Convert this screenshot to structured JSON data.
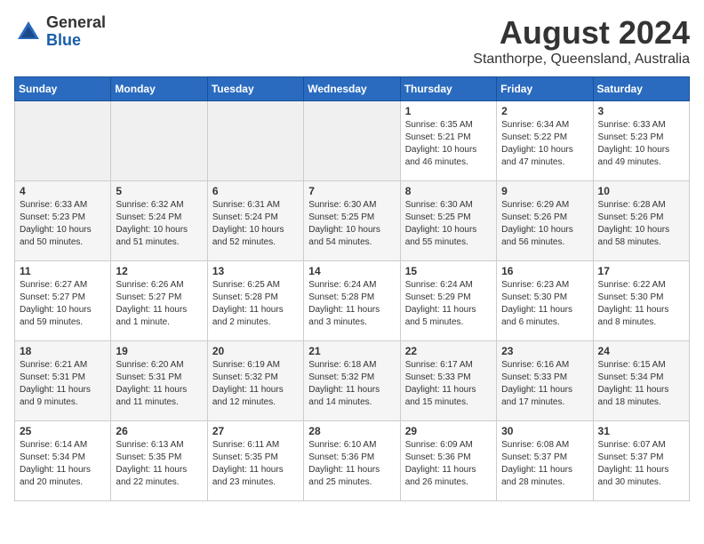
{
  "header": {
    "logo_general": "General",
    "logo_blue": "Blue",
    "month_year": "August 2024",
    "location": "Stanthorpe, Queensland, Australia"
  },
  "weekdays": [
    "Sunday",
    "Monday",
    "Tuesday",
    "Wednesday",
    "Thursday",
    "Friday",
    "Saturday"
  ],
  "weeks": [
    [
      {
        "day": "",
        "sunrise": "",
        "sunset": "",
        "daylight": ""
      },
      {
        "day": "",
        "sunrise": "",
        "sunset": "",
        "daylight": ""
      },
      {
        "day": "",
        "sunrise": "",
        "sunset": "",
        "daylight": ""
      },
      {
        "day": "",
        "sunrise": "",
        "sunset": "",
        "daylight": ""
      },
      {
        "day": "1",
        "sunrise": "Sunrise: 6:35 AM",
        "sunset": "Sunset: 5:21 PM",
        "daylight": "Daylight: 10 hours and 46 minutes."
      },
      {
        "day": "2",
        "sunrise": "Sunrise: 6:34 AM",
        "sunset": "Sunset: 5:22 PM",
        "daylight": "Daylight: 10 hours and 47 minutes."
      },
      {
        "day": "3",
        "sunrise": "Sunrise: 6:33 AM",
        "sunset": "Sunset: 5:23 PM",
        "daylight": "Daylight: 10 hours and 49 minutes."
      }
    ],
    [
      {
        "day": "4",
        "sunrise": "Sunrise: 6:33 AM",
        "sunset": "Sunset: 5:23 PM",
        "daylight": "Daylight: 10 hours and 50 minutes."
      },
      {
        "day": "5",
        "sunrise": "Sunrise: 6:32 AM",
        "sunset": "Sunset: 5:24 PM",
        "daylight": "Daylight: 10 hours and 51 minutes."
      },
      {
        "day": "6",
        "sunrise": "Sunrise: 6:31 AM",
        "sunset": "Sunset: 5:24 PM",
        "daylight": "Daylight: 10 hours and 52 minutes."
      },
      {
        "day": "7",
        "sunrise": "Sunrise: 6:30 AM",
        "sunset": "Sunset: 5:25 PM",
        "daylight": "Daylight: 10 hours and 54 minutes."
      },
      {
        "day": "8",
        "sunrise": "Sunrise: 6:30 AM",
        "sunset": "Sunset: 5:25 PM",
        "daylight": "Daylight: 10 hours and 55 minutes."
      },
      {
        "day": "9",
        "sunrise": "Sunrise: 6:29 AM",
        "sunset": "Sunset: 5:26 PM",
        "daylight": "Daylight: 10 hours and 56 minutes."
      },
      {
        "day": "10",
        "sunrise": "Sunrise: 6:28 AM",
        "sunset": "Sunset: 5:26 PM",
        "daylight": "Daylight: 10 hours and 58 minutes."
      }
    ],
    [
      {
        "day": "11",
        "sunrise": "Sunrise: 6:27 AM",
        "sunset": "Sunset: 5:27 PM",
        "daylight": "Daylight: 10 hours and 59 minutes."
      },
      {
        "day": "12",
        "sunrise": "Sunrise: 6:26 AM",
        "sunset": "Sunset: 5:27 PM",
        "daylight": "Daylight: 11 hours and 1 minute."
      },
      {
        "day": "13",
        "sunrise": "Sunrise: 6:25 AM",
        "sunset": "Sunset: 5:28 PM",
        "daylight": "Daylight: 11 hours and 2 minutes."
      },
      {
        "day": "14",
        "sunrise": "Sunrise: 6:24 AM",
        "sunset": "Sunset: 5:28 PM",
        "daylight": "Daylight: 11 hours and 3 minutes."
      },
      {
        "day": "15",
        "sunrise": "Sunrise: 6:24 AM",
        "sunset": "Sunset: 5:29 PM",
        "daylight": "Daylight: 11 hours and 5 minutes."
      },
      {
        "day": "16",
        "sunrise": "Sunrise: 6:23 AM",
        "sunset": "Sunset: 5:30 PM",
        "daylight": "Daylight: 11 hours and 6 minutes."
      },
      {
        "day": "17",
        "sunrise": "Sunrise: 6:22 AM",
        "sunset": "Sunset: 5:30 PM",
        "daylight": "Daylight: 11 hours and 8 minutes."
      }
    ],
    [
      {
        "day": "18",
        "sunrise": "Sunrise: 6:21 AM",
        "sunset": "Sunset: 5:31 PM",
        "daylight": "Daylight: 11 hours and 9 minutes."
      },
      {
        "day": "19",
        "sunrise": "Sunrise: 6:20 AM",
        "sunset": "Sunset: 5:31 PM",
        "daylight": "Daylight: 11 hours and 11 minutes."
      },
      {
        "day": "20",
        "sunrise": "Sunrise: 6:19 AM",
        "sunset": "Sunset: 5:32 PM",
        "daylight": "Daylight: 11 hours and 12 minutes."
      },
      {
        "day": "21",
        "sunrise": "Sunrise: 6:18 AM",
        "sunset": "Sunset: 5:32 PM",
        "daylight": "Daylight: 11 hours and 14 minutes."
      },
      {
        "day": "22",
        "sunrise": "Sunrise: 6:17 AM",
        "sunset": "Sunset: 5:33 PM",
        "daylight": "Daylight: 11 hours and 15 minutes."
      },
      {
        "day": "23",
        "sunrise": "Sunrise: 6:16 AM",
        "sunset": "Sunset: 5:33 PM",
        "daylight": "Daylight: 11 hours and 17 minutes."
      },
      {
        "day": "24",
        "sunrise": "Sunrise: 6:15 AM",
        "sunset": "Sunset: 5:34 PM",
        "daylight": "Daylight: 11 hours and 18 minutes."
      }
    ],
    [
      {
        "day": "25",
        "sunrise": "Sunrise: 6:14 AM",
        "sunset": "Sunset: 5:34 PM",
        "daylight": "Daylight: 11 hours and 20 minutes."
      },
      {
        "day": "26",
        "sunrise": "Sunrise: 6:13 AM",
        "sunset": "Sunset: 5:35 PM",
        "daylight": "Daylight: 11 hours and 22 minutes."
      },
      {
        "day": "27",
        "sunrise": "Sunrise: 6:11 AM",
        "sunset": "Sunset: 5:35 PM",
        "daylight": "Daylight: 11 hours and 23 minutes."
      },
      {
        "day": "28",
        "sunrise": "Sunrise: 6:10 AM",
        "sunset": "Sunset: 5:36 PM",
        "daylight": "Daylight: 11 hours and 25 minutes."
      },
      {
        "day": "29",
        "sunrise": "Sunrise: 6:09 AM",
        "sunset": "Sunset: 5:36 PM",
        "daylight": "Daylight: 11 hours and 26 minutes."
      },
      {
        "day": "30",
        "sunrise": "Sunrise: 6:08 AM",
        "sunset": "Sunset: 5:37 PM",
        "daylight": "Daylight: 11 hours and 28 minutes."
      },
      {
        "day": "31",
        "sunrise": "Sunrise: 6:07 AM",
        "sunset": "Sunset: 5:37 PM",
        "daylight": "Daylight: 11 hours and 30 minutes."
      }
    ]
  ]
}
